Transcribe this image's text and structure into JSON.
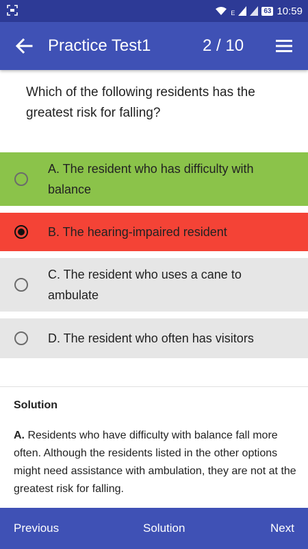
{
  "status_bar": {
    "screenshot_icon": "screenshot-icon",
    "wifi_icon": "wifi-icon",
    "e_label": "E",
    "signal1_icon": "signal-icon",
    "signal2_icon": "signal-icon",
    "battery_level": "63",
    "time": "10:59"
  },
  "app_bar": {
    "back_icon": "arrow-left-icon",
    "title": "Practice Test1",
    "counter": "2  / 10",
    "menu_icon": "hamburger-menu-icon",
    "color": "#3f51b5"
  },
  "question": {
    "text": "Which of the following residents has the greatest risk for falling?"
  },
  "options": [
    {
      "label": "A. The resident who has difficulty with balance",
      "state": "correct",
      "color": "#8bc34a",
      "selected": false
    },
    {
      "label": "B. The hearing-impaired resident",
      "state": "incorrect",
      "color": "#f44336",
      "selected": true
    },
    {
      "label": "C. The resident who uses a cane to ambulate",
      "state": "neutral",
      "color": "#e6e6e6",
      "selected": false
    },
    {
      "label": "D. The resident who often has visitors",
      "state": "neutral",
      "color": "#e6e6e6",
      "selected": false
    }
  ],
  "solution": {
    "heading": "Solution",
    "answer_letter": "A.",
    "text": " Residents who have difficulty with balance fall more often. Although the residents listed in the other options might need assistance with ambulation, they are not at the greatest risk for falling."
  },
  "bottom_bar": {
    "previous_label": "Previous",
    "solution_label": "Solution",
    "next_label": "Next"
  }
}
